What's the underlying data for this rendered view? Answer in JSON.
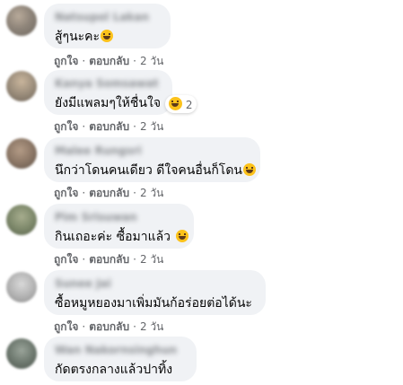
{
  "colors": {
    "bubble": "#f0f2f5",
    "text": "#050505",
    "meta": "#65676b",
    "emoji": "#fcc21b"
  },
  "comments": [
    {
      "author": "Natsupol Lakan",
      "text": "สู้ๆนะคะ",
      "emoji": "laugh-emoji",
      "like": "ถูกใจ",
      "reply": "ตอบกลับ",
      "time": "2 วัน"
    },
    {
      "author": "Kanya Somsawat",
      "text": "ยังมีแพลมๆให้ชื่นใจ",
      "reaction": {
        "emoji": "laugh-emoji",
        "count": "2"
      },
      "like": "ถูกใจ",
      "reply": "ตอบกลับ",
      "time": "2 วัน"
    },
    {
      "author": "Malee Rungsri",
      "text": "นึกว่าโดนคนเดียว ดีใจคนอื่นก็โดน",
      "emoji": "laugh-emoji",
      "like": "ถูกใจ",
      "reply": "ตอบกลับ",
      "time": "2 วัน"
    },
    {
      "author": "Pim Srisuwan",
      "text": "กินเถอะค่ะ ซื้อมาแล้ว",
      "emoji": "laugh-emoji",
      "like": "ถูกใจ",
      "reply": "ตอบกลับ",
      "time": "2 วัน"
    },
    {
      "author": "Sunee Jai",
      "text": "ซื้อหมูหยองมาเพิ่มมันก้อร่อยต่อได้นะ",
      "like": "ถูกใจ",
      "reply": "ตอบกลับ",
      "time": "2 วัน"
    },
    {
      "author": "Wan Nakornsinghun",
      "text": "กัดตรงกลางแล้วปาทิ้ง"
    }
  ]
}
